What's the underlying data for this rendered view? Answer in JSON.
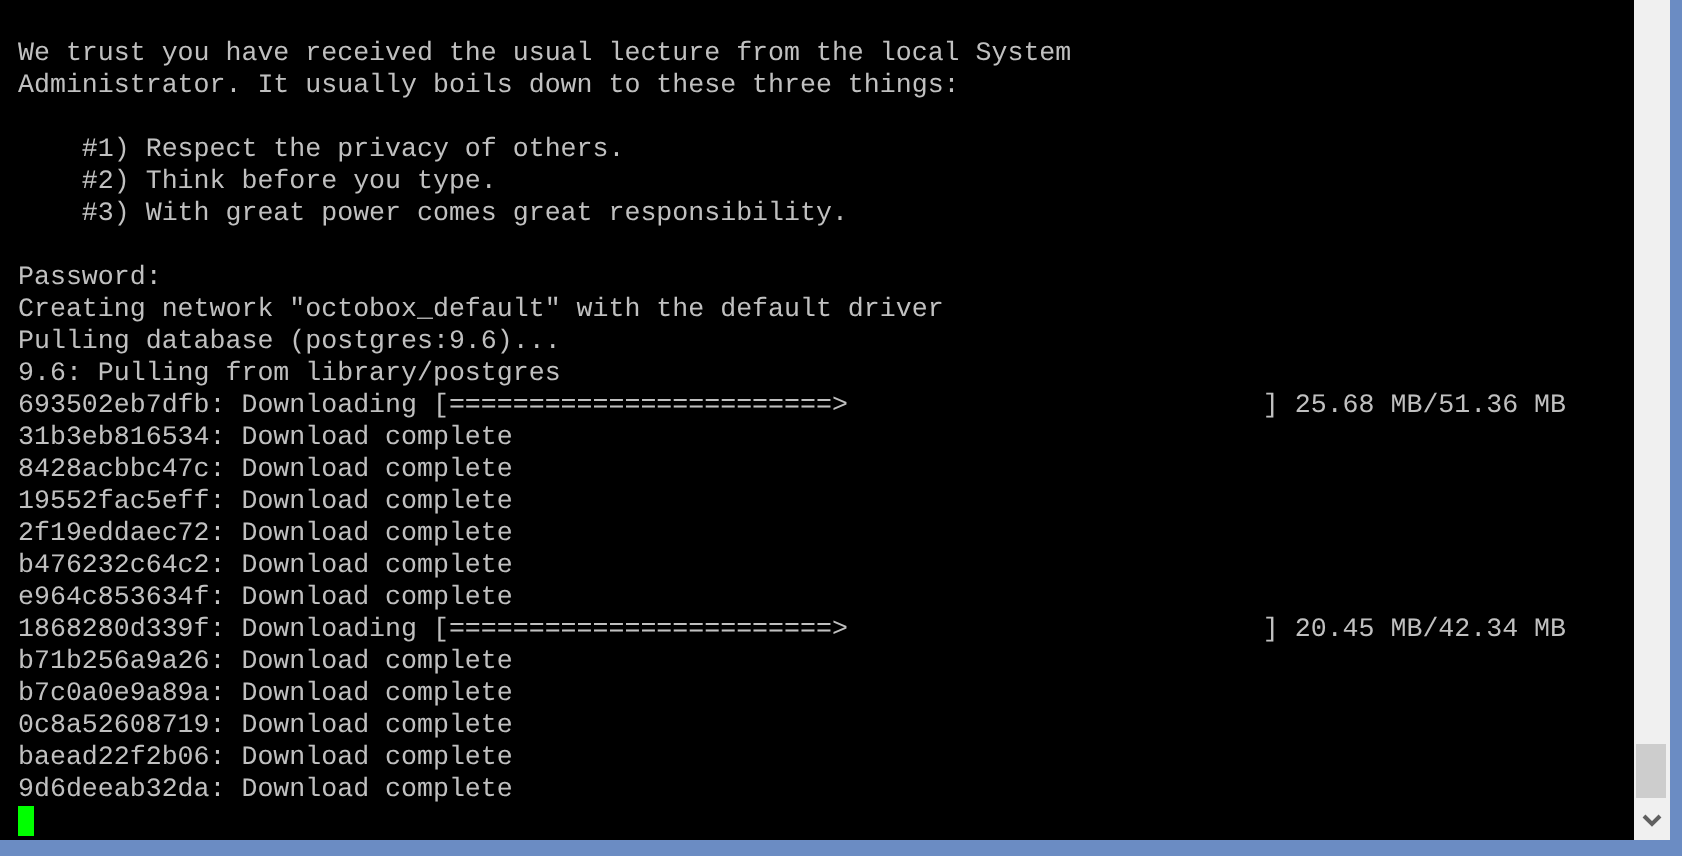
{
  "terminal": {
    "blocks": [
      {
        "lines": [
          "We trust you have received the usual lecture from the local System",
          "Administrator. It usually boils down to these three things:"
        ]
      },
      {
        "lines": [
          "    #1) Respect the privacy of others.",
          "    #2) Think before you type.",
          "    #3) With great power comes great responsibility."
        ]
      },
      {
        "lines": [
          "Password:",
          "Creating network \"octobox_default\" with the default driver",
          "Pulling database (postgres:9.6)...",
          "9.6: Pulling from library/postgres",
          "693502eb7dfb: Downloading [========================>                          ] 25.68 MB/51.36 MB",
          "31b3eb816534: Download complete",
          "8428acbbc47c: Download complete",
          "19552fac5eff: Download complete",
          "2f19eddaec72: Download complete",
          "b476232c64c2: Download complete",
          "e964c853634f: Download complete",
          "1868280d339f: Downloading [========================>                          ] 20.45 MB/42.34 MB",
          "b71b256a9a26: Download complete",
          "b7c0a0e9a89a: Download complete",
          "0c8a52608719: Download complete",
          "baead22f2b06: Download complete",
          "9d6deeab32da: Download complete"
        ]
      }
    ]
  }
}
